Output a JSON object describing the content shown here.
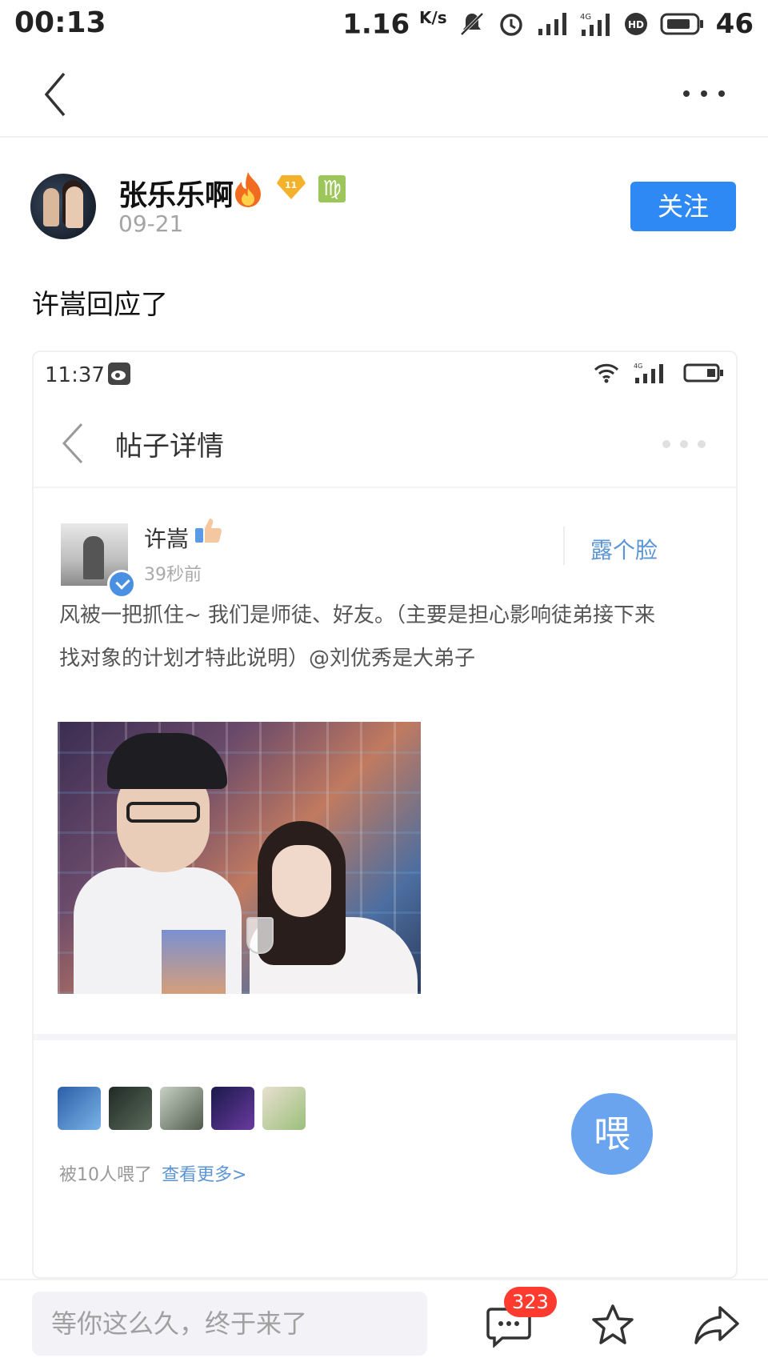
{
  "status_bar": {
    "time": "00:13",
    "speed": "1.16",
    "speed_unit": "K/s",
    "battery": "46",
    "icons": [
      "mute-icon",
      "alarm-icon",
      "signal-icon",
      "4g-signal-icon",
      "hd-icon",
      "battery-icon"
    ]
  },
  "nav": {
    "icons": [
      "back-icon",
      "more-icon"
    ]
  },
  "author": {
    "name": "张乐乐啊",
    "date": "09-21",
    "level": "11",
    "zodiac": "♍",
    "follow_label": "关注"
  },
  "post": {
    "text": "许嵩回应了"
  },
  "embedded": {
    "time": "11:37",
    "title": "帖子详情",
    "author_name": "许嵩",
    "posted": "39秒前",
    "peek_label": "露个脸",
    "body": "风被一把抓住~ 我们是师徒、好友。（主要是担心影响徒弟接下来找对象的计划才特此说明）@刘优秀是大弟子",
    "fed_text": "被10人喂了",
    "more_link": "查看更多>",
    "feed_button": "喂"
  },
  "bottom_bar": {
    "input_placeholder": "等你这么久，终于来了",
    "comment_count": "323"
  },
  "colors": {
    "accent": "#2f89f5",
    "badge": "#ff3b30",
    "link": "#5b95d4"
  }
}
